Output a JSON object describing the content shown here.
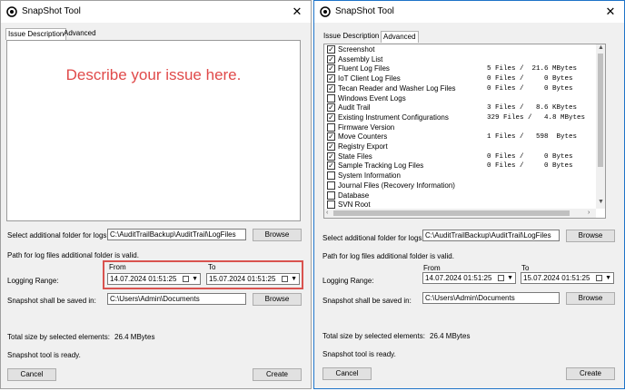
{
  "title": "SnapShot Tool",
  "tabs": [
    "Issue Description",
    "Advanced"
  ],
  "describe_placeholder": "Describe your issue here.",
  "folder_label": "Select additional folder for logs:",
  "folder_value": "C:\\AuditTrailBackup\\AuditTrail\\LogFiles",
  "browse_label": "Browse",
  "path_valid": "Path for log files additional folder is valid.",
  "from_label": "From",
  "to_label": "To",
  "logging_label": "Logging Range:",
  "from_value": "14.07.2024 01:51:25",
  "to_value": "15.07.2024 01:51:25",
  "saved_label": "Snapshot shall be saved in:",
  "saved_value": "C:\\Users\\Admin\\Documents",
  "total_label": "Total size by selected elements:",
  "total_value": "26.4 MBytes",
  "status": "Snapshot tool is ready.",
  "cancel_label": "Cancel",
  "create_label": "Create",
  "close_glyph": "✕",
  "items": [
    {
      "name": "Screenshot",
      "checked": true,
      "files": ""
    },
    {
      "name": "Assembly List",
      "checked": true,
      "files": ""
    },
    {
      "name": "Fluent Log Files",
      "checked": true,
      "files": "5 Files /  21.6 MBytes"
    },
    {
      "name": "IoT Client Log Files",
      "checked": true,
      "files": "0 Files /     0 Bytes"
    },
    {
      "name": "Tecan Reader and Washer Log Files",
      "checked": true,
      "files": "0 Files /     0 Bytes"
    },
    {
      "name": "Windows Event Logs",
      "checked": false,
      "files": ""
    },
    {
      "name": "Audit Trail",
      "checked": true,
      "files": "3 Files /   8.6 KBytes"
    },
    {
      "name": "Existing Instrument Configurations",
      "checked": true,
      "files": "329 Files /   4.8 MBytes"
    },
    {
      "name": "Firmware Version",
      "checked": false,
      "files": ""
    },
    {
      "name": "Move Counters",
      "checked": true,
      "files": "1 Files /   598  Bytes"
    },
    {
      "name": "Registry Export",
      "checked": true,
      "files": ""
    },
    {
      "name": "State Files",
      "checked": true,
      "files": "0 Files /     0 Bytes"
    },
    {
      "name": "Sample Tracking Log Files",
      "checked": true,
      "files": "0 Files /     0 Bytes"
    },
    {
      "name": "System Information",
      "checked": false,
      "files": ""
    },
    {
      "name": "Journal Files (Recovery Information)",
      "checked": false,
      "files": ""
    },
    {
      "name": "Database",
      "checked": false,
      "files": ""
    },
    {
      "name": "SVN Root",
      "checked": false,
      "files": ""
    }
  ]
}
